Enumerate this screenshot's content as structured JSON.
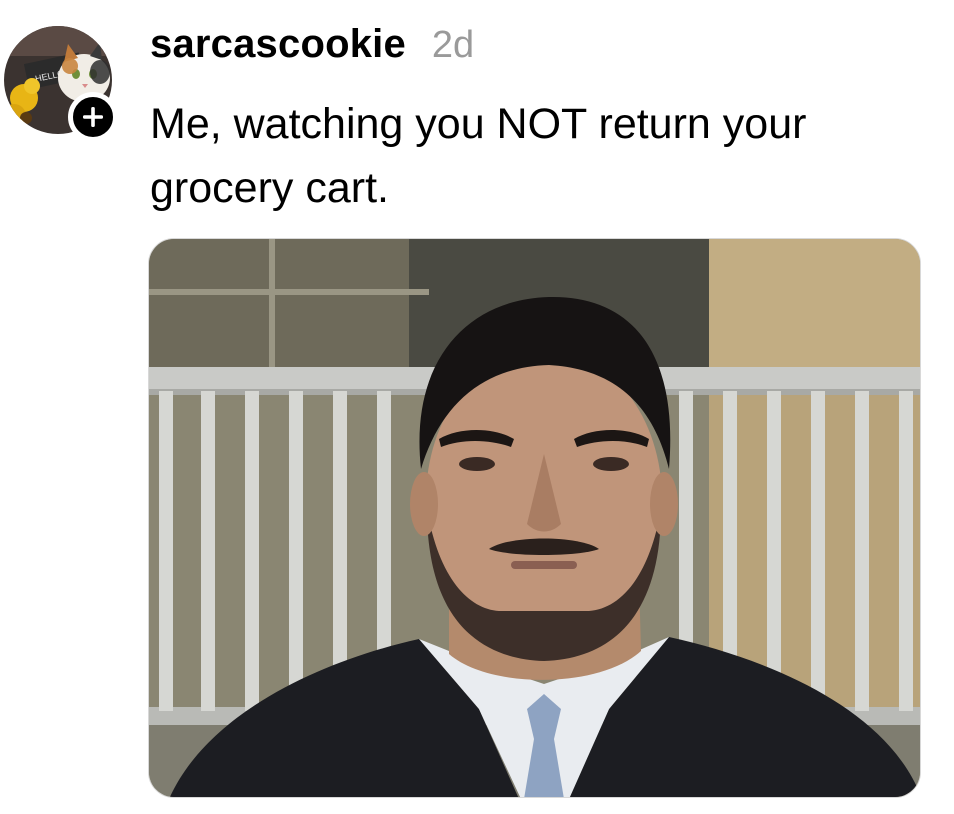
{
  "post": {
    "author": {
      "username": "sarcascookie",
      "avatar_badge_text": "HELLO",
      "avatar_icon": "avatar-photo-cat-sunflower"
    },
    "timestamp": "2d",
    "caption": "Me, watching you NOT return your grocery cart.",
    "follow_icon": "plus-icon",
    "media": {
      "type": "photo",
      "icon": "photo-image"
    }
  },
  "colors": {
    "text": "#000000",
    "timestamp": "#9a9a9a",
    "badge_bg": "#000000",
    "background": "#ffffff"
  }
}
